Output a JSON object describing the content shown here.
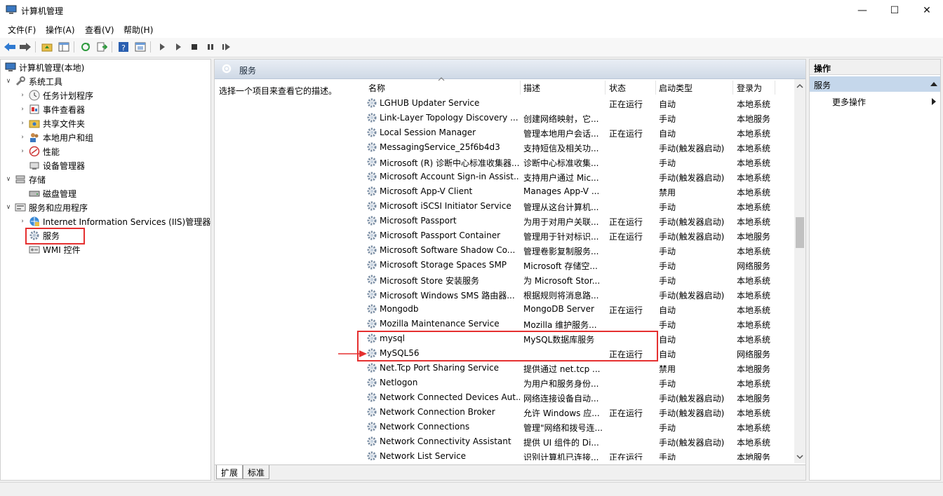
{
  "window": {
    "title": "计算机管理"
  },
  "window_buttons": {
    "minimize": "—",
    "maximize": "☐",
    "close": "✕"
  },
  "menu": [
    "文件(F)",
    "操作(A)",
    "查看(V)",
    "帮助(H)"
  ],
  "tree": [
    {
      "label": "计算机管理(本地)",
      "icon": "computer-icon",
      "level": 0,
      "arrow": ""
    },
    {
      "label": "系统工具",
      "icon": "tools-icon",
      "level": 1,
      "arrow": "v"
    },
    {
      "label": "任务计划程序",
      "icon": "clock-icon",
      "level": 2,
      "arrow": ">"
    },
    {
      "label": "事件查看器",
      "icon": "event-viewer-icon",
      "level": 2,
      "arrow": ">"
    },
    {
      "label": "共享文件夹",
      "icon": "shared-folder-icon",
      "level": 2,
      "arrow": ">"
    },
    {
      "label": "本地用户和组",
      "icon": "users-icon",
      "level": 2,
      "arrow": ">"
    },
    {
      "label": "性能",
      "icon": "performance-icon",
      "level": 2,
      "arrow": ">"
    },
    {
      "label": "设备管理器",
      "icon": "device-manager-icon",
      "level": 2,
      "arrow": ""
    },
    {
      "label": "存储",
      "icon": "storage-icon",
      "level": 1,
      "arrow": "v"
    },
    {
      "label": "磁盘管理",
      "icon": "disk-icon",
      "level": 2,
      "arrow": ""
    },
    {
      "label": "服务和应用程序",
      "icon": "services-apps-icon",
      "level": 1,
      "arrow": "v"
    },
    {
      "label": "Internet Information Services (IIS)管理器",
      "icon": "iis-icon",
      "level": 2,
      "arrow": ">"
    },
    {
      "label": "服务",
      "icon": "gear-icon",
      "level": 2,
      "arrow": ""
    },
    {
      "label": "WMI 控件",
      "icon": "wmi-icon",
      "level": 2,
      "arrow": ""
    }
  ],
  "center": {
    "header": "服务",
    "description": "选择一个项目来查看它的描述。",
    "columns": {
      "name": "名称",
      "desc": "描述",
      "state": "状态",
      "start": "启动类型",
      "logon": "登录为"
    },
    "rows": [
      {
        "name": "LGHUB Updater Service",
        "desc": "",
        "state": "正在运行",
        "start": "自动",
        "logon": "本地系统"
      },
      {
        "name": "Link-Layer Topology Discovery ...",
        "desc": "创建网络映射，它...",
        "state": "",
        "start": "手动",
        "logon": "本地服务"
      },
      {
        "name": "Local Session Manager",
        "desc": "管理本地用户会话...",
        "state": "正在运行",
        "start": "自动",
        "logon": "本地系统"
      },
      {
        "name": "MessagingService_25f6b4d3",
        "desc": "支持短信及相关功...",
        "state": "",
        "start": "手动(触发器启动)",
        "logon": "本地系统"
      },
      {
        "name": "Microsoft (R) 诊断中心标准收集器...",
        "desc": "诊断中心标准收集...",
        "state": "",
        "start": "手动",
        "logon": "本地系统"
      },
      {
        "name": "Microsoft Account Sign-in Assist...",
        "desc": "支持用户通过 Mic...",
        "state": "",
        "start": "手动(触发器启动)",
        "logon": "本地系统"
      },
      {
        "name": "Microsoft App-V Client",
        "desc": "Manages App-V ...",
        "state": "",
        "start": "禁用",
        "logon": "本地系统"
      },
      {
        "name": "Microsoft iSCSI Initiator Service",
        "desc": "管理从这台计算机...",
        "state": "",
        "start": "手动",
        "logon": "本地系统"
      },
      {
        "name": "Microsoft Passport",
        "desc": "为用于对用户关联...",
        "state": "正在运行",
        "start": "手动(触发器启动)",
        "logon": "本地系统"
      },
      {
        "name": "Microsoft Passport Container",
        "desc": "管理用于针对标识...",
        "state": "正在运行",
        "start": "手动(触发器启动)",
        "logon": "本地服务"
      },
      {
        "name": "Microsoft Software Shadow Co...",
        "desc": "管理卷影复制服务...",
        "state": "",
        "start": "手动",
        "logon": "本地系统"
      },
      {
        "name": "Microsoft Storage Spaces SMP",
        "desc": "Microsoft 存储空...",
        "state": "",
        "start": "手动",
        "logon": "网络服务"
      },
      {
        "name": "Microsoft Store 安装服务",
        "desc": "为 Microsoft Stor...",
        "state": "",
        "start": "手动",
        "logon": "本地系统"
      },
      {
        "name": "Microsoft Windows SMS 路由器...",
        "desc": "根据规则将消息路...",
        "state": "",
        "start": "手动(触发器启动)",
        "logon": "本地系统"
      },
      {
        "name": "Mongodb",
        "desc": "MongoDB Server",
        "state": "正在运行",
        "start": "自动",
        "logon": "本地系统"
      },
      {
        "name": "Mozilla Maintenance Service",
        "desc": "Mozilla 维护服务...",
        "state": "",
        "start": "手动",
        "logon": "本地系统"
      },
      {
        "name": "mysql",
        "desc": "MySQL数据库服务",
        "state": "",
        "start": "自动",
        "logon": "本地系统"
      },
      {
        "name": "MySQL56",
        "desc": "",
        "state": "正在运行",
        "start": "自动",
        "logon": "网络服务"
      },
      {
        "name": "Net.Tcp Port Sharing Service",
        "desc": "提供通过 net.tcp ...",
        "state": "",
        "start": "禁用",
        "logon": "本地服务"
      },
      {
        "name": "Netlogon",
        "desc": "为用户和服务身份...",
        "state": "",
        "start": "手动",
        "logon": "本地系统"
      },
      {
        "name": "Network Connected Devices Aut...",
        "desc": "网络连接设备自动...",
        "state": "",
        "start": "手动(触发器启动)",
        "logon": "本地服务"
      },
      {
        "name": "Network Connection Broker",
        "desc": "允许 Windows 应...",
        "state": "正在运行",
        "start": "手动(触发器启动)",
        "logon": "本地系统"
      },
      {
        "name": "Network Connections",
        "desc": "管理\"网络和拨号连...",
        "state": "",
        "start": "手动",
        "logon": "本地系统"
      },
      {
        "name": "Network Connectivity Assistant",
        "desc": "提供 UI 组件的 Di...",
        "state": "",
        "start": "手动(触发器启动)",
        "logon": "本地系统"
      },
      {
        "name": "Network List Service",
        "desc": "识别计算机已连接...",
        "state": "正在运行",
        "start": "手动",
        "logon": "本地服务"
      }
    ]
  },
  "tabs": [
    "扩展",
    "标准"
  ],
  "actions": {
    "header": "操作",
    "group": "服务",
    "more": "更多操作"
  },
  "colors": {
    "highlight_box": "#e53030",
    "actions_group_bg": "#c5d7eb"
  }
}
